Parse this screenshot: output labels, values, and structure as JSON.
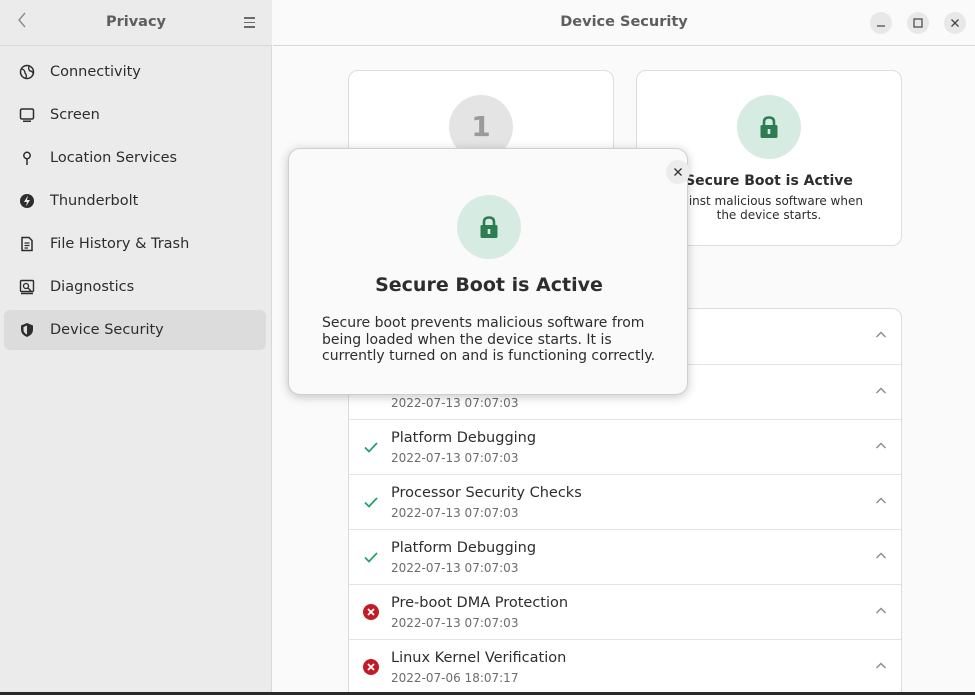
{
  "sidebar": {
    "back_label": "〈",
    "title": "Privacy",
    "items": [
      {
        "label": "Connectivity",
        "icon": "globe-icon"
      },
      {
        "label": "Screen",
        "icon": "monitor-icon"
      },
      {
        "label": "Location Services",
        "icon": "location-pin-icon"
      },
      {
        "label": "Thunderbolt",
        "icon": "thunderbolt-icon"
      },
      {
        "label": "File History & Trash",
        "icon": "document-icon"
      },
      {
        "label": "Diagnostics",
        "icon": "diagnostics-icon"
      },
      {
        "label": "Device Security",
        "icon": "shield-icon",
        "active": true
      }
    ]
  },
  "header": {
    "title": "Device Security"
  },
  "summary": {
    "level_number": "1",
    "secure_boot_title": "Secure Boot is Active",
    "secure_boot_desc_line1": "ted against malicious software when",
    "secure_boot_desc_line2": "the device starts."
  },
  "checks": [
    {
      "name": "",
      "timestamp": "",
      "status": "hidden"
    },
    {
      "name": "",
      "timestamp": "2022-07-13 07:07:03",
      "status": "hidden"
    },
    {
      "name": "Platform Debugging",
      "timestamp": "2022-07-13 07:07:03",
      "status": "pass"
    },
    {
      "name": "Processor Security Checks",
      "timestamp": "2022-07-13 07:07:03",
      "status": "pass"
    },
    {
      "name": "Platform Debugging",
      "timestamp": "2022-07-13 07:07:03",
      "status": "pass"
    },
    {
      "name": "Pre-boot DMA Protection",
      "timestamp": "2022-07-13 07:07:03",
      "status": "fail"
    },
    {
      "name": "Linux Kernel Verification",
      "timestamp": "2022-07-06 18:07:17",
      "status": "fail"
    }
  ],
  "dialog": {
    "title": "Secure Boot is Active",
    "body": "Secure boot prevents malicious software from being loaded when the device starts. It is currently turned on and is functioning correctly."
  },
  "colors": {
    "accent_green": "#26a269",
    "lock_green": "#2e7d52",
    "fail_red": "#c01c28"
  }
}
